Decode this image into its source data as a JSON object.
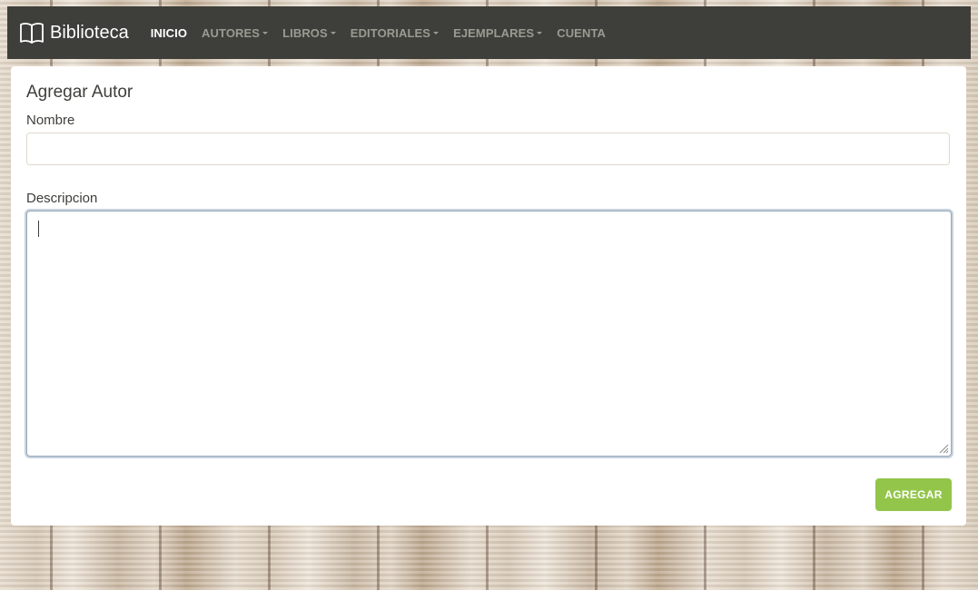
{
  "navbar": {
    "brand": "Biblioteca",
    "items": [
      {
        "label": "INICIO",
        "active": true,
        "dropdown": false
      },
      {
        "label": "AUTORES",
        "active": false,
        "dropdown": true
      },
      {
        "label": "LIBROS",
        "active": false,
        "dropdown": true
      },
      {
        "label": "EDITORIALES",
        "active": false,
        "dropdown": true
      },
      {
        "label": "EJEMPLARES",
        "active": false,
        "dropdown": true
      },
      {
        "label": "CUENTA",
        "active": false,
        "dropdown": false
      }
    ]
  },
  "form": {
    "title": "Agregar Autor",
    "nombre_label": "Nombre",
    "nombre_value": "",
    "descripcion_label": "Descripcion",
    "descripcion_value": "",
    "submit_label": "AGREGAR"
  },
  "colors": {
    "navbar_bg": "#3e3f3a",
    "button_bg": "#93c54b",
    "text": "#3e3f3a"
  },
  "icons": {
    "brand": "book-open-icon",
    "dropdown": "caret-down-icon"
  }
}
